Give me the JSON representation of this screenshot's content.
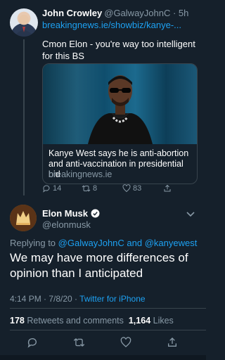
{
  "quoted_tweet": {
    "author_name": "John Crowley",
    "author_handle": "@GalwayJohnC · 5h",
    "link": "breakingnews.ie/showbiz/kanye-...",
    "text": "Cmon Elon - you're way too intelligent for this BS",
    "card": {
      "title": "Kanye West says he is anti-abortion and anti-vaccination in presidential bid",
      "domain": "breakingnews.ie"
    },
    "actions": {
      "replies": "14",
      "retweets": "8",
      "likes": "83"
    }
  },
  "main_tweet": {
    "author_name": "Elon Musk",
    "author_handle": "@elonmusk",
    "replying_prefix": "Replying to",
    "replying_to": "@GalwayJohnC and @kanyewest",
    "text": "We may have more differences of opinion than I anticipated",
    "timestamp": "4:14 PM · 7/8/20 · ",
    "source": "Twitter for iPhone",
    "retweets_count": "178",
    "retweets_label": "Retweets and comments",
    "likes_count": "1,164",
    "likes_label": "Likes"
  },
  "colors": {
    "background": "#15202b",
    "accent": "#1da1f2",
    "secondary_text": "#8899a6",
    "divider": "#38444d"
  }
}
